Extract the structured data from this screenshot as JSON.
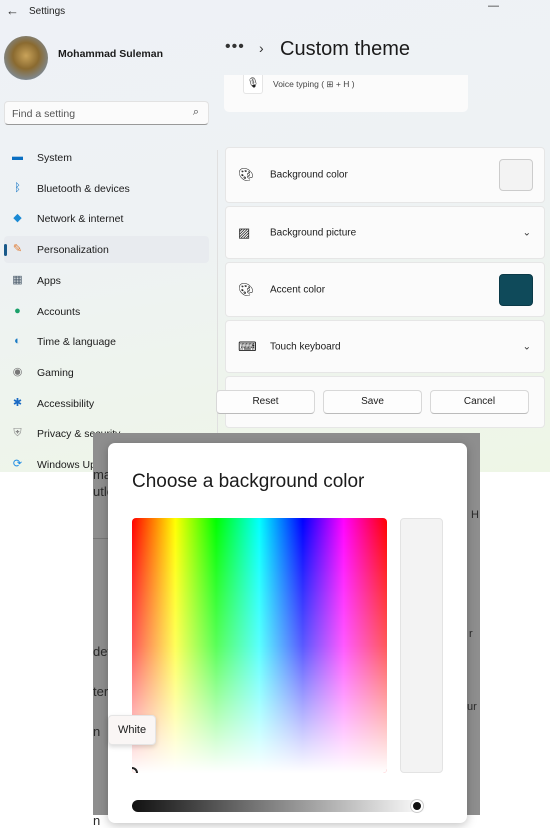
{
  "window": {
    "title": "Settings",
    "back_icon": "arrow-left-icon",
    "minimize_icon": "minimize-icon"
  },
  "user": {
    "name": "Mohammad Suleman"
  },
  "search": {
    "placeholder": "Find a setting",
    "icon": "search-icon"
  },
  "sidebar": {
    "selected": "Personalization",
    "items": [
      {
        "label": "System",
        "icon": "monitor-icon",
        "color": "#0a6fc2"
      },
      {
        "label": "Bluetooth & devices",
        "icon": "bluetooth-icon",
        "color": "#0a6fc2"
      },
      {
        "label": "Network & internet",
        "icon": "wifi-icon",
        "color": "#1a8ad4"
      },
      {
        "label": "Personalization",
        "icon": "brush-icon",
        "color": "#e07a30"
      },
      {
        "label": "Apps",
        "icon": "apps-icon",
        "color": "#4a5a6a"
      },
      {
        "label": "Accounts",
        "icon": "person-icon",
        "color": "#1aa06a"
      },
      {
        "label": "Time & language",
        "icon": "globe-clock-icon",
        "color": "#1a7ac4"
      },
      {
        "label": "Gaming",
        "icon": "gamepad-icon",
        "color": "#777777"
      },
      {
        "label": "Accessibility",
        "icon": "accessibility-icon",
        "color": "#1a6ac4"
      },
      {
        "label": "Privacy & security",
        "icon": "shield-icon",
        "color": "#888888"
      },
      {
        "label": "Windows Update",
        "icon": "update-icon",
        "color": "#1a8ae4"
      }
    ]
  },
  "header": {
    "breadcrumb_more": "•••",
    "title": "Custom theme"
  },
  "voice_card": {
    "text": "Voice typing ( ⊞ + H )",
    "icon": "microphone-icon"
  },
  "cards": [
    {
      "label": "Background color",
      "icon": "palette-icon",
      "swatch": "#f3f3f3"
    },
    {
      "label": "Background picture",
      "icon": "image-icon",
      "control": "chevron-down-icon"
    },
    {
      "label": "Accent color",
      "icon": "palette-icon",
      "swatch": "#0f4a5a"
    },
    {
      "label": "Touch keyboard",
      "icon": "keyboard-icon",
      "control": "chevron-down-icon"
    }
  ],
  "buttons": {
    "reset": "Reset",
    "save": "Save",
    "cancel": "Cancel"
  },
  "backdrop_fragments": [
    "mac",
    "utlo",
    "dev",
    "ter",
    "n",
    "n",
    "H",
    "r",
    "ur"
  ],
  "dialog": {
    "title": "Choose a background color",
    "selected_color": "#f3f3f3",
    "brightness_percent": 97,
    "tooltip": "White"
  }
}
